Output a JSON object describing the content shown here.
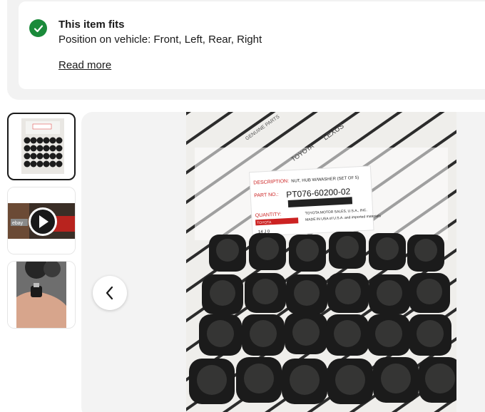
{
  "fits": {
    "title": "This item fits",
    "position_text": "Position on vehicle: Front, Left, Rear, Right",
    "read_more": "Read more",
    "status_color": "#1a8a3a"
  },
  "gallery": {
    "thumbnails": [
      {
        "label": "lug nuts photo"
      },
      {
        "label": "video thumbnail",
        "badge": "ebay"
      },
      {
        "label": "lug nut in hand photo"
      }
    ],
    "main_image": {
      "description_label": "DESCRIPTION:",
      "description_value": "NUT, HUB W/WASHER (SET OF 5)",
      "part_label": "PART NO.:",
      "part_number": "PT076-60200-02",
      "quantity_label": "QUANTITY:",
      "brand_text": "TOYOTA",
      "lexus_text": "LEXUS",
      "genuine_text": "GENUINE PARTS",
      "made_in": "MADE IN USA of U.S.A. and imported materials",
      "distributor": "TOYOTA MOTOR SALES, U.S.A., INC.",
      "code": "14 J 0"
    },
    "prev_icon": "chevron-left-icon"
  }
}
